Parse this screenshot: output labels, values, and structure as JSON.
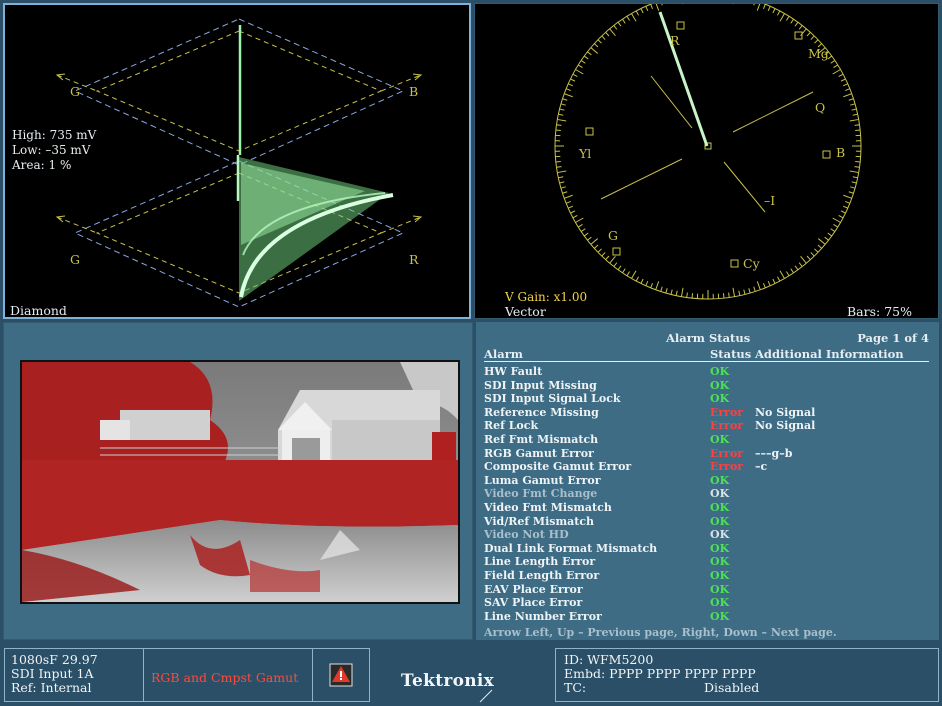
{
  "diamond": {
    "label_g_top": "G",
    "label_b_top": "B",
    "label_g_bottom": "G",
    "label_r_bottom": "R",
    "high": "High: 735 mV",
    "low": "Low: –35 mV",
    "area": "Area:  1 %",
    "panel_label": "Diamond"
  },
  "vector": {
    "labels": {
      "r": "R",
      "mg": "Mg",
      "q": "Q",
      "b": "B",
      "yl": "Yl",
      "i": "–I",
      "g": "G",
      "cy": "Cy"
    },
    "v_gain": "V Gain: x1.00",
    "panel_label": "Vector",
    "bars": "Bars: 75%"
  },
  "alarm_status": {
    "title": "Alarm Status",
    "page": "Page 1 of 4",
    "headers": {
      "alarm": "Alarm",
      "status": "Status",
      "info": "Additional Information"
    },
    "rows": [
      {
        "name": "HW Fault",
        "status": "OK",
        "info": "",
        "dim": false
      },
      {
        "name": "SDI Input Missing",
        "status": "OK",
        "info": "",
        "dim": false
      },
      {
        "name": "SDI Input Signal Lock",
        "status": "OK",
        "info": "",
        "dim": false
      },
      {
        "name": "Reference Missing",
        "status": "Error",
        "info": "No Signal",
        "dim": false
      },
      {
        "name": "Ref Lock",
        "status": "Error",
        "info": "No Signal",
        "dim": false
      },
      {
        "name": "Ref Fmt Mismatch",
        "status": "OK",
        "info": "",
        "dim": false
      },
      {
        "name": "RGB Gamut Error",
        "status": "Error",
        "info": "–––g–b",
        "dim": false
      },
      {
        "name": "Composite Gamut Error",
        "status": "Error",
        "info": "–c",
        "dim": false
      },
      {
        "name": "Luma Gamut Error",
        "status": "OK",
        "info": "",
        "dim": false
      },
      {
        "name": "Video Fmt Change",
        "status": "OK",
        "info": "",
        "dim": true
      },
      {
        "name": "Video Fmt Mismatch",
        "status": "OK",
        "info": "",
        "dim": false
      },
      {
        "name": "Vid/Ref Mismatch",
        "status": "OK",
        "info": "",
        "dim": false
      },
      {
        "name": "Video Not HD",
        "status": "OK",
        "info": "",
        "dim": true
      },
      {
        "name": "Dual Link Format Mismatch",
        "status": "OK",
        "info": "",
        "dim": false
      },
      {
        "name": "Line Length Error",
        "status": "OK",
        "info": "",
        "dim": false
      },
      {
        "name": "Field Length Error",
        "status": "OK",
        "info": "",
        "dim": false
      },
      {
        "name": "EAV Place Error",
        "status": "OK",
        "info": "",
        "dim": false
      },
      {
        "name": "SAV Place Error",
        "status": "OK",
        "info": "",
        "dim": false
      },
      {
        "name": "Line Number Error",
        "status": "OK",
        "info": "",
        "dim": false
      }
    ],
    "hint": "Arrow Left, Up – Previous page, Right, Down – Next page."
  },
  "status_bar": {
    "format": "1080sF 29.97",
    "input": "SDI Input 1A",
    "ref": "Ref: Internal",
    "gamut_alarm": "RGB and Cmpst Gamut",
    "brand": "Tektronix",
    "id": "ID: WFM5200",
    "embd": "Embd: PPPP PPPP PPPP PPPP",
    "tc_label": "TC:",
    "tc_value": "Disabled"
  },
  "colors": {
    "ok": "#4fe05a",
    "error": "#ff4040",
    "trace": "#9ff0a8",
    "graticule": "#c8c24a",
    "gamut_dash": "#8aa8e0"
  }
}
